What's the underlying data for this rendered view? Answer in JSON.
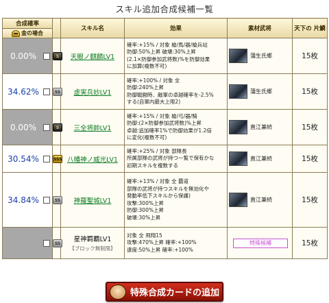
{
  "title": "スキル追加合成候補一覧",
  "headers": {
    "rate": "合成確率",
    "king_case": "金の場合",
    "skill_name": "スキル名",
    "effect": "効果",
    "source": "素材武将",
    "heaven_count": "天下の 片鱗"
  },
  "rows": [
    {
      "pct": "0.00%",
      "bg": "gray",
      "rarity": "S",
      "skill": "天眼ノ麒麟LV1",
      "link": true,
      "meta": "",
      "effect": [
        "確率:+15% / 対象 槍/馬/器/槍兵站",
        "防御:50%上昇  破壊:30%上昇",
        "(2.1×防御参加武将数)%を防御効果",
        "に加算(複数不可)"
      ],
      "source": "蒲生氏郷",
      "special": "",
      "count": "15枚",
      "checked": false
    },
    {
      "pct": "34.62%",
      "bg": "white",
      "rarity": "SS",
      "skill": "虚実兵妙LV1",
      "link": true,
      "meta": "",
      "effect": [
        "確率:+100% / 対象 全",
        "防御:240%上昇",
        "防御戦闘時、敵軍の卓越確率を-2.5%",
        "する(自軍内最大上限2)"
      ],
      "source": "蒲生氏郷",
      "special": "",
      "count": "15枚",
      "checked": false
    },
    {
      "pct": "0.00%",
      "bg": "gray",
      "rarity": "S",
      "skill": "三全将帥LV1",
      "link": true,
      "meta": "",
      "effect": [
        "確率:+15% / 対象 槍/弓/器/騎",
        "防御:(2×防御参加武将数)%上昇",
        "卓越:追加確率1%で防御効果が1.2倍",
        "に変化(複数不可)"
      ],
      "source": "直江兼続",
      "special": "",
      "count": "15枚",
      "checked": false
    },
    {
      "pct": "30.54%",
      "bg": "white",
      "rarity": "SSS",
      "skill": "八幡神ノ威光LV1",
      "link": true,
      "meta": "",
      "effect": [
        "確率:+25% / 対象 部隊長",
        "所属部隊の武将が持つ一覧で保有かな",
        "初期スキルを複数する"
      ],
      "source": "直江兼続",
      "special": "",
      "count": "15枚",
      "checked": false
    },
    {
      "pct": "34.84%",
      "bg": "white",
      "rarity": "SS",
      "skill": "神羅聖城LV1",
      "link": true,
      "meta": "",
      "effect": [
        "確率:+13% / 対象 全 覇道",
        "部隊の武将が持つスキルを無効化や",
        "発動率低下スキルから保護)",
        "攻撃:300%上昇",
        "防御:300%上昇",
        "破壊:30%上昇"
      ],
      "source": "直江兼続",
      "special": "",
      "count": "15枚",
      "checked": false
    },
    {
      "pct": "",
      "bg": "gray",
      "rarity": "SS",
      "skill": "星神羁覇LV1",
      "link": false,
      "meta": "【ブロック無制限】",
      "effect": [
        "対象 全 飛翔15",
        "攻撃:470%上昇  確率:+100%",
        "速度:50%上昇  確率:+100%"
      ],
      "source": "",
      "special": "特殊候補",
      "count": "15枚",
      "checked": false
    }
  ],
  "footer_button": "特殊合成カードの追加"
}
